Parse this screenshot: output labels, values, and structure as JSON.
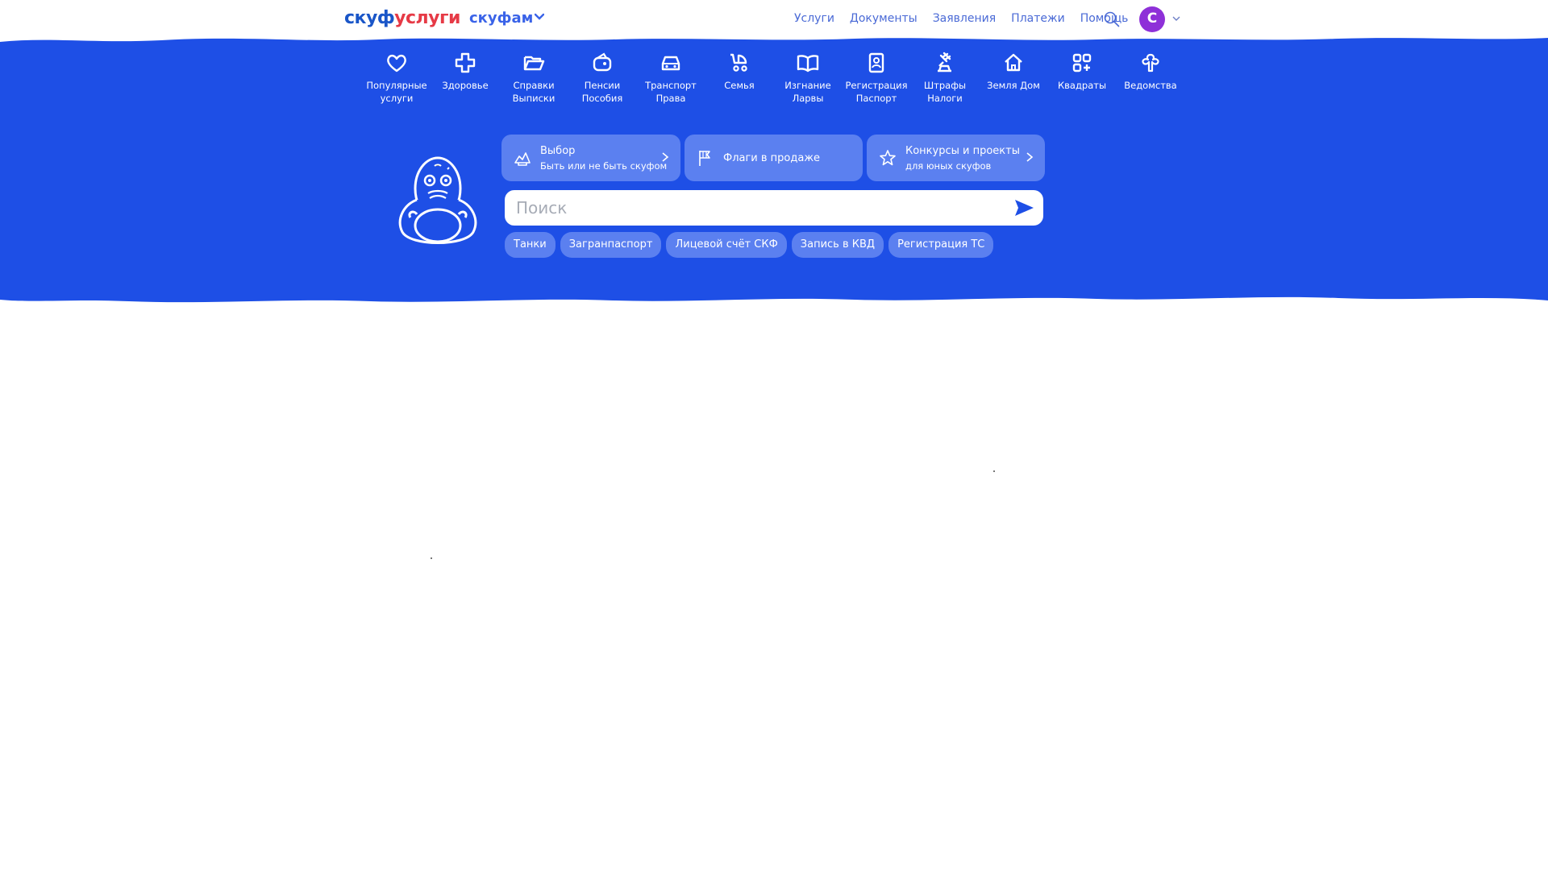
{
  "header": {
    "logo": {
      "part1": "скуф",
      "part2": "услуги"
    },
    "family_link": "скуфам",
    "nav": [
      "Услуги",
      "Документы",
      "Заявления",
      "Платежи",
      "Помощь"
    ],
    "avatar_letter": "С"
  },
  "categories": [
    {
      "label": "Популярные\nуслуги",
      "icon": "heart-icon"
    },
    {
      "label": "Здоровье",
      "icon": "medical-cross-icon"
    },
    {
      "label": "Справки\nВыписки",
      "icon": "folder-icon"
    },
    {
      "label": "Пенсии\nПособия",
      "icon": "wallet-icon"
    },
    {
      "label": "Транспорт\nПрава",
      "icon": "car-icon"
    },
    {
      "label": "Семья",
      "icon": "stroller-icon"
    },
    {
      "label": "Изгнание\nЛарвы",
      "icon": "book-icon"
    },
    {
      "label": "Регистрация\nПаспорт",
      "icon": "passport-icon"
    },
    {
      "label": "Штрафы\nНалоги",
      "icon": "gavel-icon"
    },
    {
      "label": "Земля Дом",
      "icon": "house-icon"
    },
    {
      "label": "Квадраты",
      "icon": "squares-icon"
    },
    {
      "label": "Ведомства",
      "icon": "emblem-icon"
    }
  ],
  "promos": [
    {
      "title": "Выбор",
      "subtitle": "Быть  или не быть скуфом",
      "icon": "ballot-icon"
    },
    {
      "title": "Флаги в продаже",
      "subtitle": "",
      "icon": "flag-icon"
    },
    {
      "title": "Конкурсы и проекты",
      "subtitle": "для юных скуфов",
      "icon": "star-icon"
    }
  ],
  "search": {
    "placeholder": "Поиск",
    "value": ""
  },
  "quick_links": [
    "Танки",
    "Загранпаспорт",
    "Лицевой счёт СКФ",
    "Запись в КВД",
    "Регистрация ТС"
  ],
  "colors": {
    "banner": "#1e4fe6",
    "card": "#5b80f0",
    "logo_blue": "#1a56c8",
    "logo_red": "#e63a46",
    "avatar": "#8e30d8"
  }
}
